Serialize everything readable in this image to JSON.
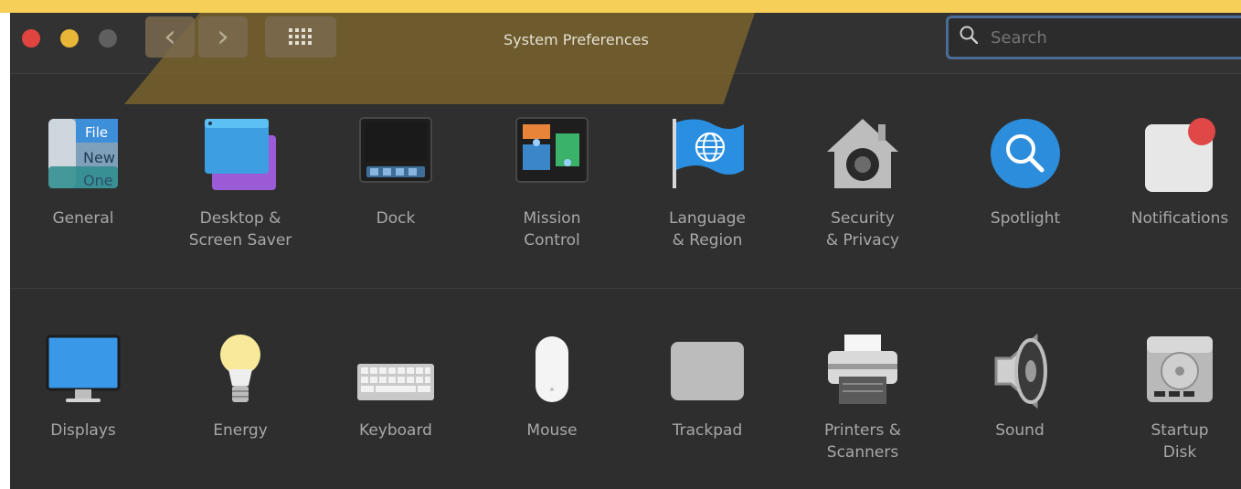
{
  "window": {
    "title": "System Preferences"
  },
  "toolbar": {
    "back_label": "‹",
    "forward_label": "›"
  },
  "search": {
    "placeholder": "Search"
  },
  "panes_row1": [
    {
      "label": "General",
      "icon": "general-icon"
    },
    {
      "label": "Desktop &\nScreen Saver",
      "icon": "desktop-screensaver-icon"
    },
    {
      "label": "Dock",
      "icon": "dock-icon"
    },
    {
      "label": "Mission\nControl",
      "icon": "mission-control-icon"
    },
    {
      "label": "Language\n& Region",
      "icon": "globe-flag-icon"
    },
    {
      "label": "Security\n& Privacy",
      "icon": "house-lock-icon"
    },
    {
      "label": "Spotlight",
      "icon": "magnifier-icon"
    },
    {
      "label": "Notifications",
      "icon": "notification-badge-icon"
    }
  ],
  "panes_row2": [
    {
      "label": "Displays",
      "icon": "monitor-icon"
    },
    {
      "label": "Energy",
      "icon": "lightbulb-icon"
    },
    {
      "label": "Keyboard",
      "icon": "keyboard-icon"
    },
    {
      "label": "Mouse",
      "icon": "mouse-icon"
    },
    {
      "label": "Trackpad",
      "icon": "trackpad-icon"
    },
    {
      "label": "Printers &\nScanners",
      "icon": "printer-icon"
    },
    {
      "label": "Sound",
      "icon": "speaker-icon"
    },
    {
      "label": "Startup\nDisk",
      "icon": "hard-drive-icon"
    }
  ],
  "general_icon_text": {
    "line1": "File",
    "line2": "New",
    "line3": "One"
  },
  "colors": {
    "close": "#e0443f",
    "minimize": "#e8b737",
    "zoom": "#5f5f5f",
    "accent_yellow": "#f6cf58",
    "search_border": "#4a6d95"
  }
}
